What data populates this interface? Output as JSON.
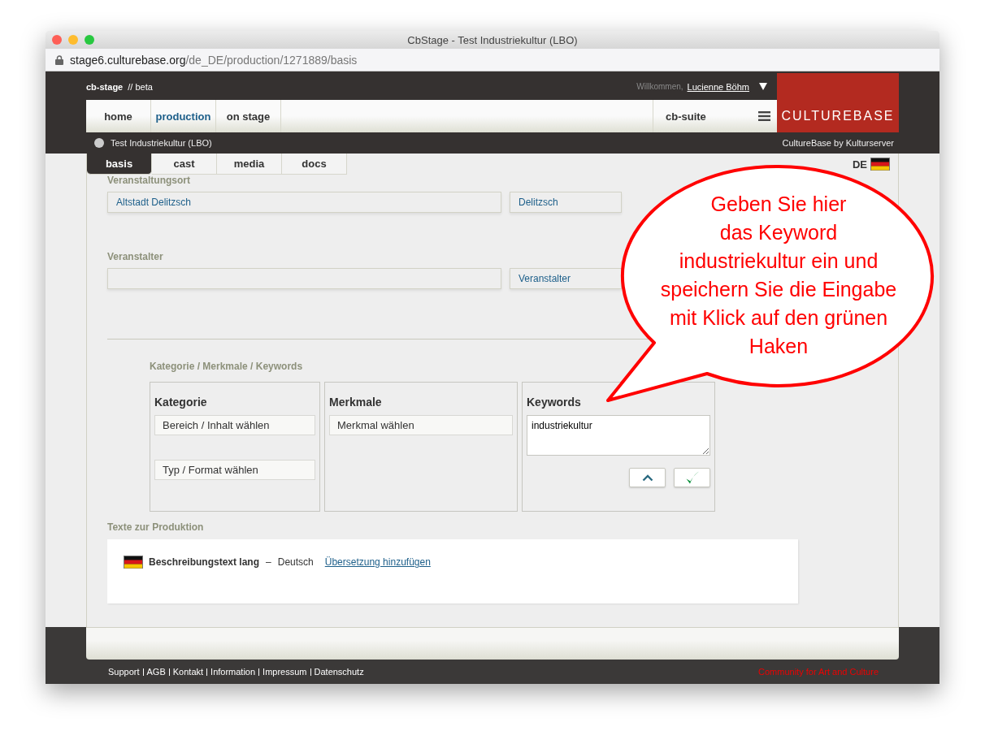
{
  "window": {
    "title": "CbStage - Test Industriekultur (LBO)",
    "url_host": "stage6.culturebase.org",
    "url_path": "/de_DE/production/1271889/basis"
  },
  "header": {
    "brand": "cb-stage",
    "tag": "// beta",
    "welcome": "Willkommen,",
    "user": "Lucienne Böhm",
    "logo": "CULTUREBASE",
    "byline": "CultureBase by Kulturserver",
    "production_title": "Test Industriekultur (LBO)"
  },
  "nav": [
    {
      "label": "home",
      "selected": false
    },
    {
      "label": "production",
      "selected": true
    },
    {
      "label": "on stage",
      "selected": false
    }
  ],
  "suite": {
    "label": "cb-suite"
  },
  "tabs": [
    {
      "label": "basis",
      "selected": true
    },
    {
      "label": "cast",
      "selected": false
    },
    {
      "label": "media",
      "selected": false
    },
    {
      "label": "docs",
      "selected": false
    }
  ],
  "language": {
    "label": "DE"
  },
  "places": [
    {
      "heading": "Veranstaltungsort",
      "value": "Altstadt Delitzsch",
      "side": "Delitzsch"
    },
    {
      "heading": "Veranstalter",
      "side": "Veranstalter"
    }
  ],
  "categories": {
    "heading": "Kategorie / Merkmale / Keywords",
    "kategorie": {
      "title": "Kategorie",
      "selects": [
        "Bereich / Inhalt wählen",
        "Typ / Format wählen"
      ]
    },
    "merkmale": {
      "title": "Merkmale",
      "selects": [
        "Merkmal wählen"
      ]
    },
    "keywords": {
      "title": "Keywords",
      "value": "industriekultur"
    }
  },
  "texts": {
    "heading": "Texte zur Produktion",
    "name": "Beschreibungstext lang",
    "dash": "–",
    "language": "Deutsch",
    "link": "Übersetzung hinzufügen"
  },
  "footer": {
    "links": [
      "Support",
      "AGB",
      "Kontakt",
      "Information",
      "Impressum",
      "Datenschutz"
    ],
    "slogan": "Community for Art and Culture"
  },
  "callout": {
    "lines": [
      "Geben Sie hier",
      "das Keyword",
      "industriekultur ein und",
      "speichern Sie die Eingabe",
      "mit Klick auf den grünen",
      "Haken"
    ]
  }
}
